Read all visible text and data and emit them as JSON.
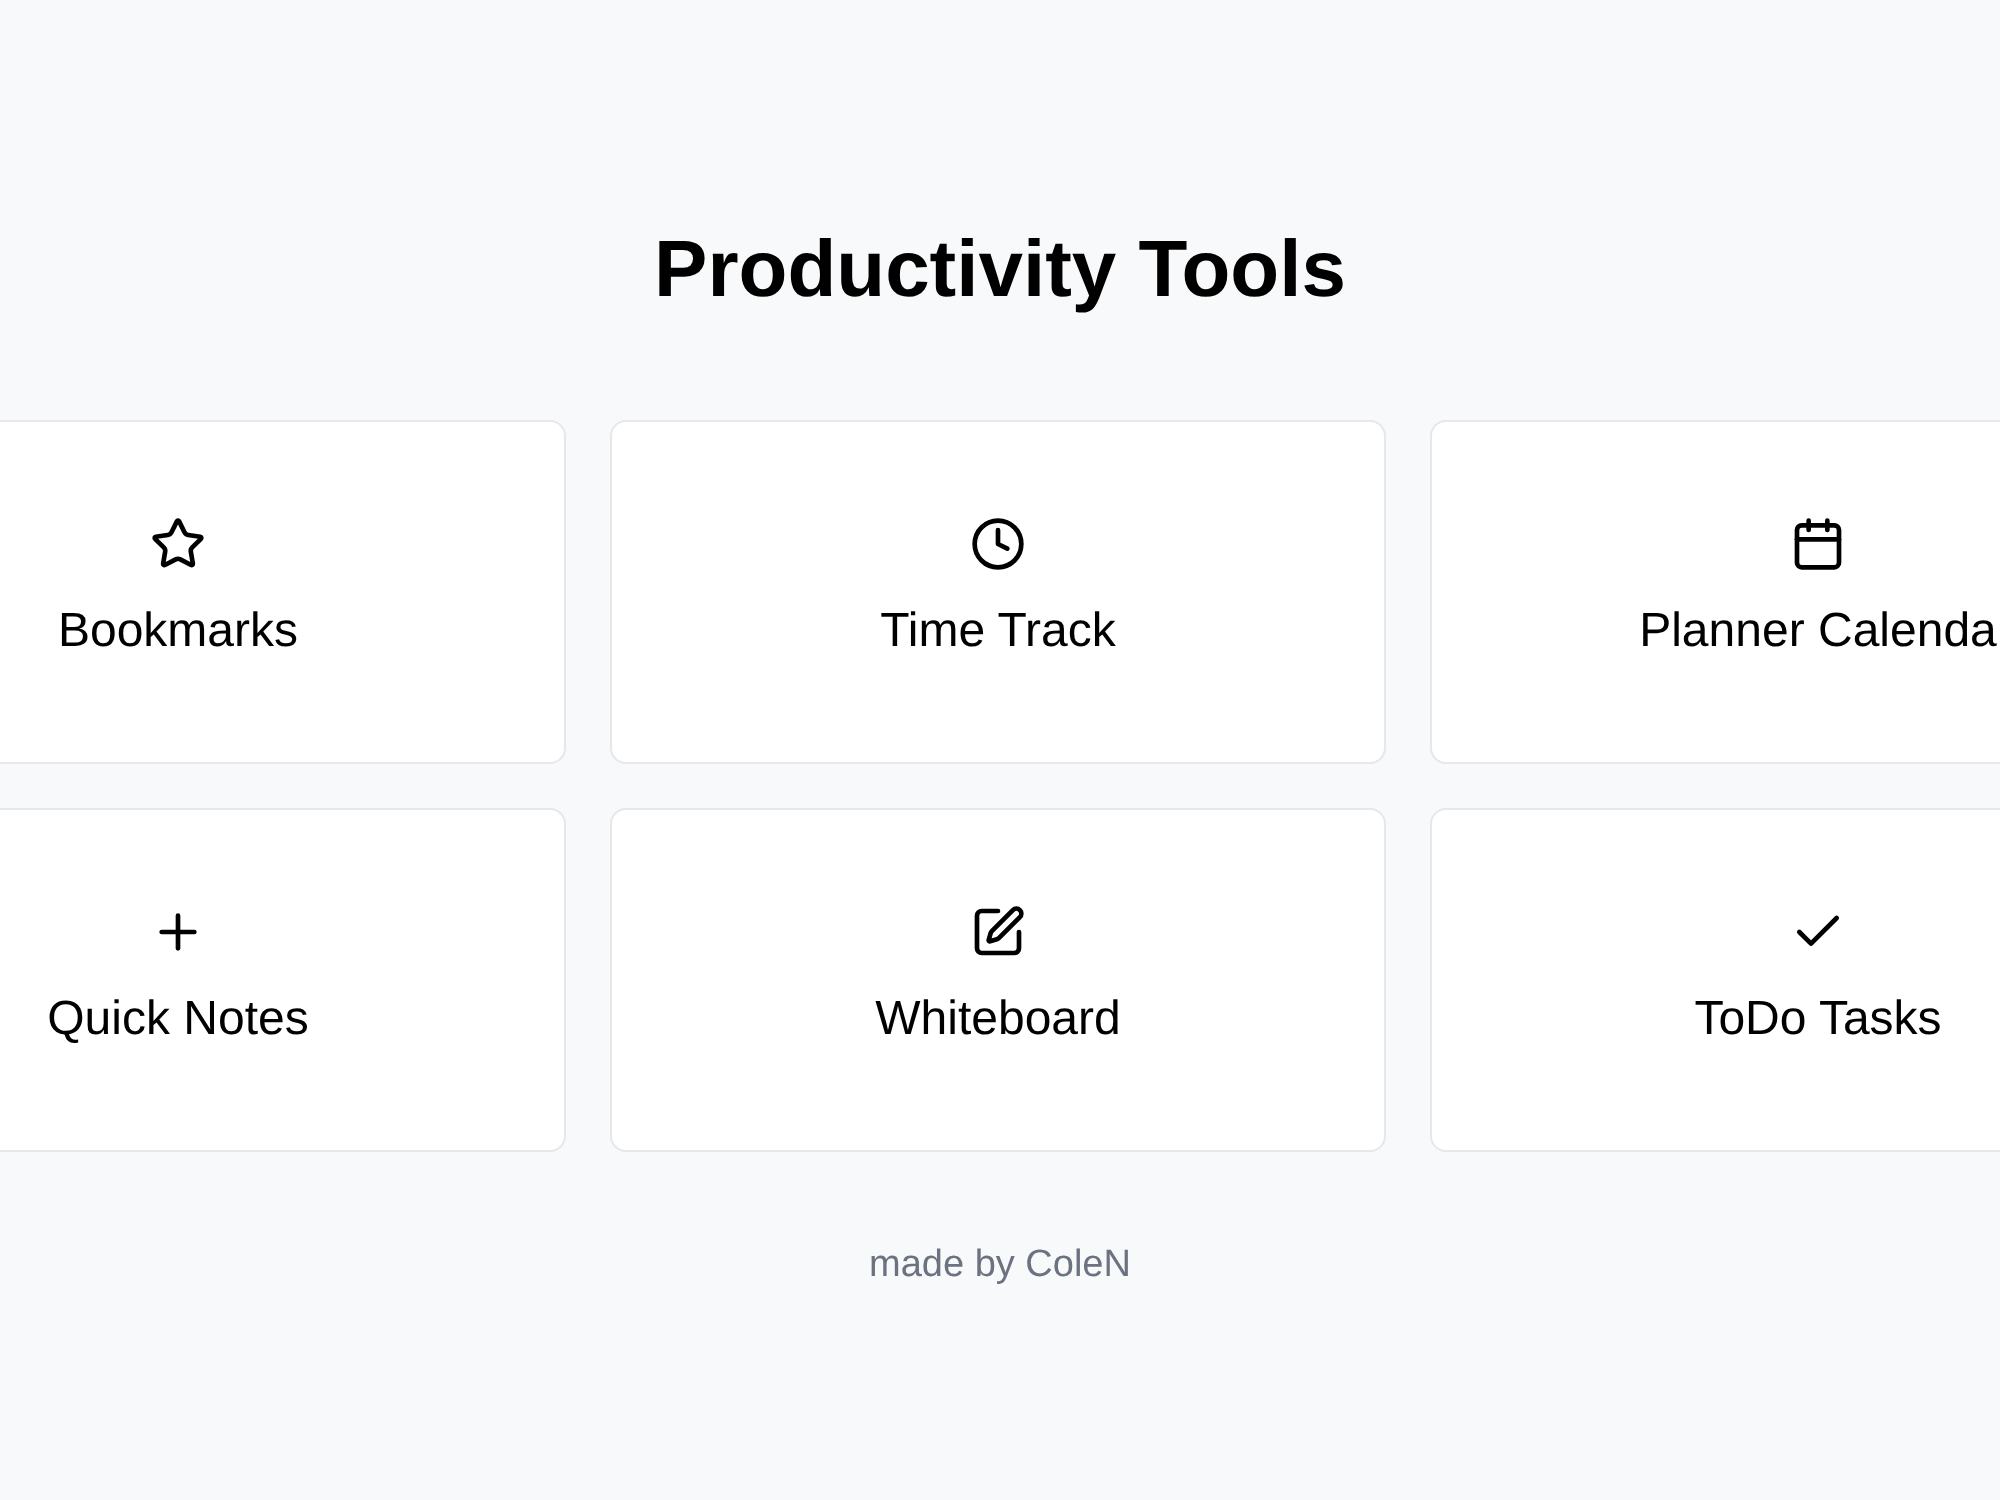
{
  "title": "Productivity Tools",
  "tools": [
    {
      "kind": "star",
      "label": "Bookmarks"
    },
    {
      "kind": "clock",
      "label": "Time Track"
    },
    {
      "kind": "calendar",
      "label": "Planner Calenda"
    },
    {
      "kind": "plus",
      "label": "Quick Notes"
    },
    {
      "kind": "pen",
      "label": "Whiteboard"
    },
    {
      "kind": "check",
      "label": "ToDo Tasks"
    }
  ],
  "footer": "made by ColeN"
}
